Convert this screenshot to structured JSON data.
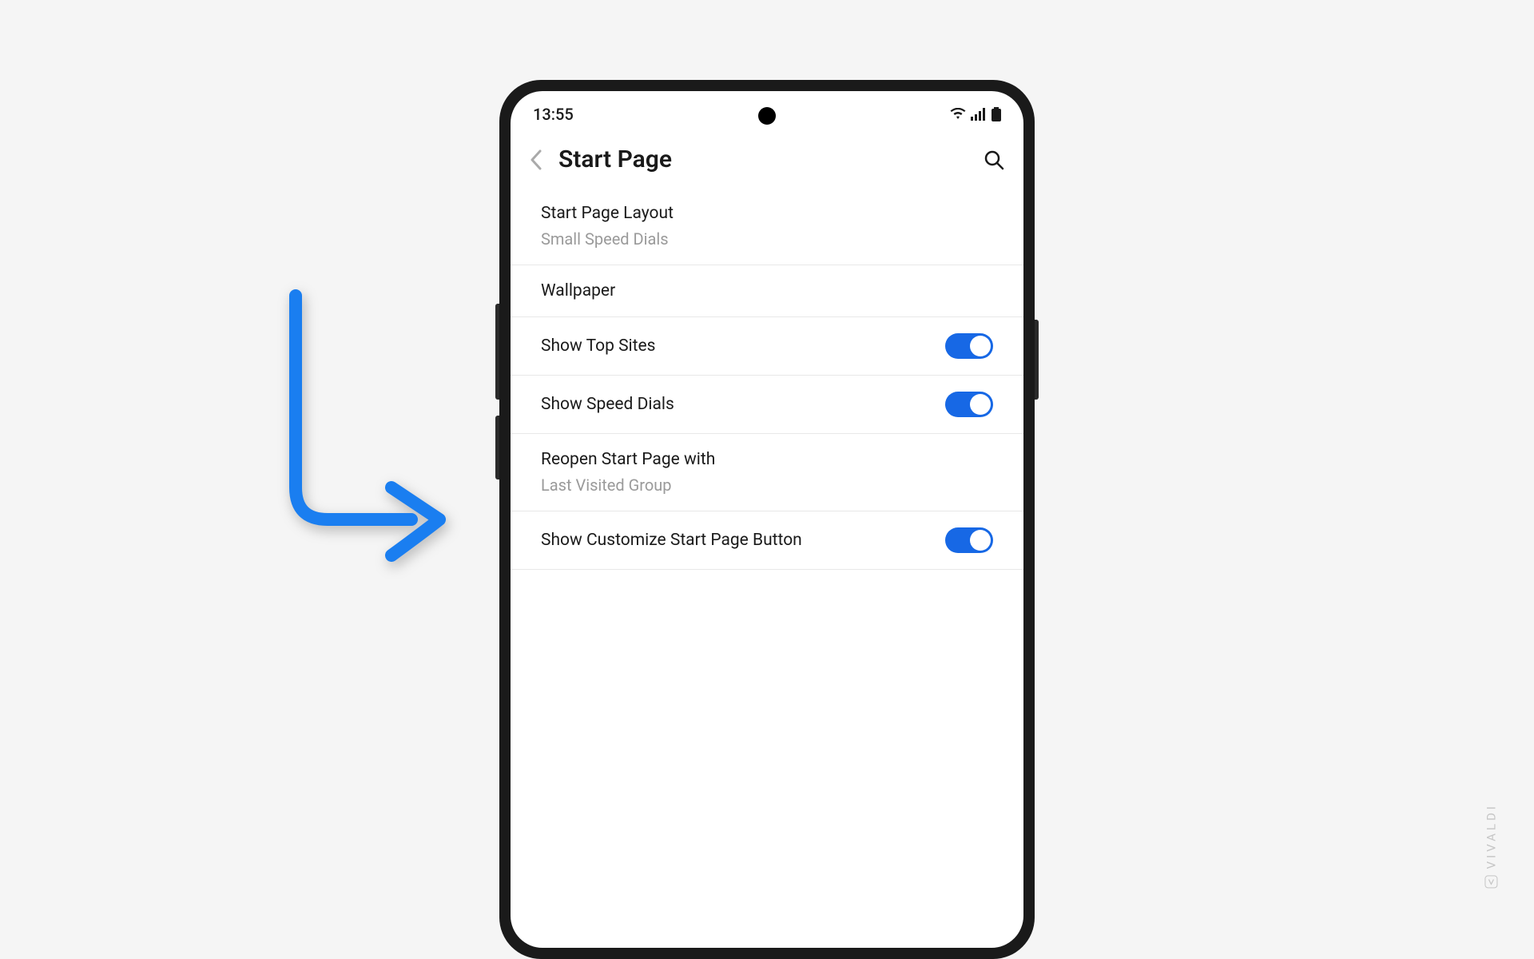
{
  "status_bar": {
    "time": "13:55"
  },
  "header": {
    "title": "Start Page"
  },
  "settings": [
    {
      "label": "Start Page Layout",
      "value": "Small Speed Dials",
      "has_toggle": false
    },
    {
      "label": "Wallpaper",
      "value": null,
      "has_toggle": false
    },
    {
      "label": "Show Top Sites",
      "value": null,
      "has_toggle": true,
      "toggle_on": true
    },
    {
      "label": "Show Speed Dials",
      "value": null,
      "has_toggle": true,
      "toggle_on": true
    },
    {
      "label": "Reopen Start Page with",
      "value": "Last Visited Group",
      "has_toggle": false
    },
    {
      "label": "Show Customize Start Page Button",
      "value": null,
      "has_toggle": true,
      "toggle_on": true
    }
  ],
  "watermark": {
    "text": "VIVALDI"
  },
  "colors": {
    "toggle_active": "#1768e5",
    "annotation_arrow": "#1a7ef0",
    "background": "#f5f5f5"
  }
}
